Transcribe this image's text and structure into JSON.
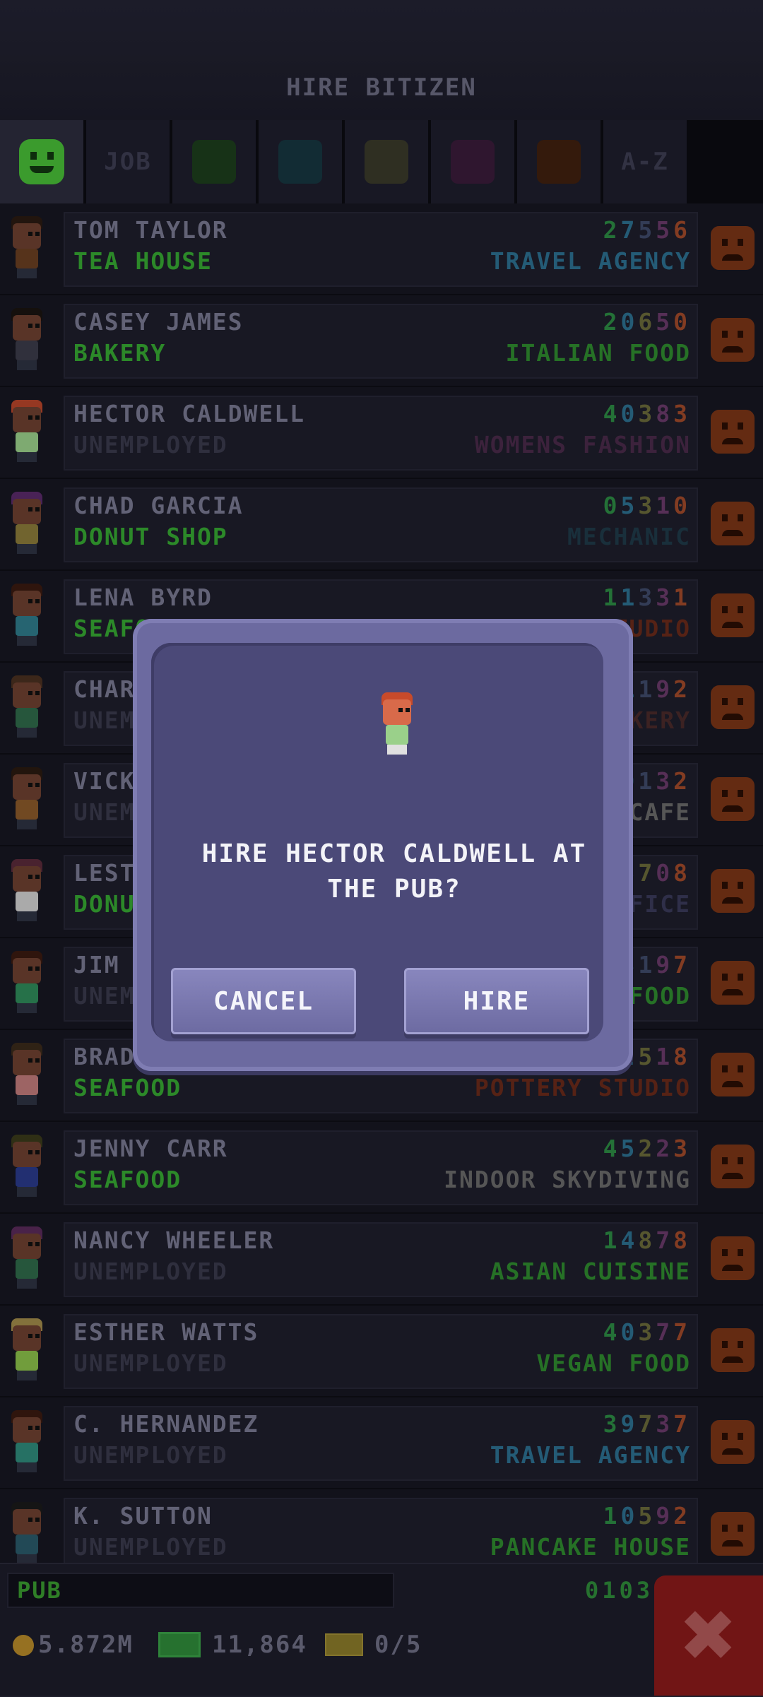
{
  "header": {
    "title": "HIRE BITIZEN"
  },
  "tabs": [
    {
      "type": "icon",
      "icon": "smiley-face-icon",
      "color": "#48bd38",
      "active": true
    },
    {
      "type": "text",
      "label": "JOB"
    },
    {
      "type": "swatch",
      "color": "#1d3d1d"
    },
    {
      "type": "swatch",
      "color": "#173640"
    },
    {
      "type": "swatch",
      "color": "#3a3a2a"
    },
    {
      "type": "swatch",
      "color": "#3a1c3a"
    },
    {
      "type": "swatch",
      "color": "#40200f"
    },
    {
      "type": "text",
      "label": "A-Z"
    }
  ],
  "rows": [
    {
      "name": "TOM TAYLOR",
      "job": "TEA HOUSE",
      "job_color": "#36a832",
      "digits": [
        "2",
        "7",
        "5",
        "5",
        "6"
      ],
      "digit_colors": [
        "#2d8a44",
        "#2d6f8f",
        "#3f4a6a",
        "#6a3a6a",
        "#a04a2a"
      ],
      "dream": "TRAVEL AGENCY",
      "dream_color": "#2c7090",
      "mood": "sad-face-icon",
      "hair": "#2a1a12",
      "shirt": "#6a3f22"
    },
    {
      "name": "CASEY JAMES",
      "job": "BAKERY",
      "job_color": "#36a832",
      "digits": [
        "2",
        "0",
        "6",
        "5",
        "0"
      ],
      "digit_colors": [
        "#2d8a44",
        "#2d6f8f",
        "#6a6a3a",
        "#6a3a6a",
        "#a04a2a"
      ],
      "dream": "ITALIAN FOOD",
      "dream_color": "#2f8a2f",
      "mood": "sad-face-icon",
      "hair": "#1a1410",
      "shirt": "#3b3b4a"
    },
    {
      "name": "HECTOR CALDWELL",
      "job": "UNEMPLOYED",
      "job_color": "#3a3a4c",
      "digits": [
        "4",
        "0",
        "3",
        "8",
        "3"
      ],
      "digit_colors": [
        "#2d8a44",
        "#2d6f8f",
        "#6a6a3a",
        "#6a3a6a",
        "#a04a2a"
      ],
      "dream": "WOMENS FASHION",
      "dream_color": "#4a2a4a",
      "mood": "sad-face-icon",
      "hair": "#b8452a",
      "shirt": "#9ad08a"
    },
    {
      "name": "CHAD GARCIA",
      "job": "DONUT SHOP",
      "job_color": "#36a832",
      "digits": [
        "0",
        "5",
        "3",
        "1",
        "0"
      ],
      "digit_colors": [
        "#2d8a44",
        "#2d6f8f",
        "#6a6a3a",
        "#6a3a6a",
        "#a04a2a"
      ],
      "dream": "MECHANIC",
      "dream_color": "#1f3a48",
      "mood": "sad-face-icon",
      "hair": "#5a2a6a",
      "shirt": "#8a7a3a"
    },
    {
      "name": "LENA BYRD",
      "job": "SEAFOOD",
      "job_color": "#36a832",
      "digits": [
        "1",
        "1",
        "3",
        "3",
        "1"
      ],
      "digit_colors": [
        "#2d8a44",
        "#2d6f8f",
        "#3f4a6a",
        "#6a3a6a",
        "#a04a2a"
      ],
      "dream": "POTTERY STUDIO",
      "dream_color": "#6a2a1a",
      "mood": "sad-face-icon",
      "hair": "#3a1a10",
      "shirt": "#2f7a8a"
    },
    {
      "name": "CHARLIE",
      "job": "UNEMPLOYED",
      "job_color": "#3a3a4c",
      "digits": [
        "4",
        "1",
        "1",
        "9",
        "2"
      ],
      "digit_colors": [
        "#2d8a44",
        "#2d6f8f",
        "#3f4a6a",
        "#6a3a6a",
        "#a04a2a"
      ],
      "dream": "BAKERY",
      "dream_color": "#4a2a2a",
      "mood": "sad-face-icon",
      "hair": "#4a3020",
      "shirt": "#2f6a4a"
    },
    {
      "name": "VICKY",
      "job": "UNEMPLOYED",
      "job_color": "#3a3a4c",
      "digits": [
        "3",
        "0",
        "1",
        "3",
        "2"
      ],
      "digit_colors": [
        "#2d8a44",
        "#2d6f8f",
        "#3f4a6a",
        "#6a3a6a",
        "#a04a2a"
      ],
      "dream": "CAFE",
      "dream_color": "#6a6a6a",
      "mood": "sad-face-icon",
      "hair": "#2a1a10",
      "shirt": "#8a5a2a"
    },
    {
      "name": "LESTER",
      "job": "DONUT SHOP",
      "job_color": "#36a832",
      "digits": [
        "1",
        "5",
        "7",
        "0",
        "8"
      ],
      "digit_colors": [
        "#2d8a44",
        "#2d6f8f",
        "#6a6a3a",
        "#6a3a6a",
        "#a04a2a"
      ],
      "dream": "OFFICE",
      "dream_color": "#3a3a5a",
      "mood": "sad-face-icon",
      "hair": "#5a2a3a",
      "shirt": "#d0d0d0"
    },
    {
      "name": "JIM",
      "job": "UNEMPLOYED",
      "job_color": "#3a3a4c",
      "digits": [
        "2",
        "3",
        "1",
        "9",
        "7"
      ],
      "digit_colors": [
        "#2d8a44",
        "#2d6f8f",
        "#3f4a6a",
        "#6a3a6a",
        "#a04a2a"
      ],
      "dream": "FOOD",
      "dream_color": "#2f8a2f",
      "mood": "sad-face-icon",
      "hair": "#3a1a10",
      "shirt": "#2f8a5a"
    },
    {
      "name": "BRAD",
      "job": "SEAFOOD",
      "job_color": "#36a832",
      "digits": [
        "4",
        "2",
        "5",
        "1",
        "8"
      ],
      "digit_colors": [
        "#2d8a44",
        "#2d6f8f",
        "#6a6a3a",
        "#6a3a6a",
        "#a04a2a"
      ],
      "dream": "POTTERY STUDIO",
      "dream_color": "#6a2a1a",
      "mood": "sad-face-icon",
      "hair": "#3a2a1a",
      "shirt": "#c07a7a"
    },
    {
      "name": "JENNY CARR",
      "job": "SEAFOOD",
      "job_color": "#36a832",
      "digits": [
        "4",
        "5",
        "2",
        "2",
        "3"
      ],
      "digit_colors": [
        "#2d8a44",
        "#2d6f8f",
        "#6a6a3a",
        "#6a3a6a",
        "#a04a2a"
      ],
      "dream": "INDOOR SKYDIVING",
      "dream_color": "#6a6a6a",
      "mood": "sad-face-icon",
      "hair": "#3a3a1a",
      "shirt": "#2a3a8a"
    },
    {
      "name": "NANCY WHEELER",
      "job": "UNEMPLOYED",
      "job_color": "#3a3a4c",
      "digits": [
        "1",
        "4",
        "8",
        "7",
        "8"
      ],
      "digit_colors": [
        "#2d8a44",
        "#2d6f8f",
        "#6a6a3a",
        "#6a3a6a",
        "#a04a2a"
      ],
      "dream": "ASIAN CUISINE",
      "dream_color": "#2f8a2f",
      "mood": "sad-face-icon",
      "hair": "#5a2a5a",
      "shirt": "#2f6a4a"
    },
    {
      "name": "ESTHER WATTS",
      "job": "UNEMPLOYED",
      "job_color": "#3a3a4c",
      "digits": [
        "4",
        "0",
        "3",
        "7",
        "7"
      ],
      "digit_colors": [
        "#2d8a44",
        "#2d6f8f",
        "#6a6a3a",
        "#6a3a6a",
        "#a04a2a"
      ],
      "dream": "VEGAN FOOD",
      "dream_color": "#2f8a2f",
      "mood": "sad-face-icon",
      "hair": "#a08a4a",
      "shirt": "#8ac04a"
    },
    {
      "name": "C. HERNANDEZ",
      "job": "UNEMPLOYED",
      "job_color": "#3a3a4c",
      "digits": [
        "3",
        "9",
        "7",
        "3",
        "7"
      ],
      "digit_colors": [
        "#2d8a44",
        "#2d6f8f",
        "#6a6a3a",
        "#6a3a6a",
        "#a04a2a"
      ],
      "dream": "TRAVEL AGENCY",
      "dream_color": "#2c7090",
      "mood": "sad-face-icon",
      "hair": "#3a1a10",
      "shirt": "#2f8a7a"
    },
    {
      "name": "K. SUTTON",
      "job": "UNEMPLOYED",
      "job_color": "#3a3a4c",
      "digits": [
        "1",
        "0",
        "5",
        "9",
        "2"
      ],
      "digit_colors": [
        "#2d8a44",
        "#2d6f8f",
        "#6a6a3a",
        "#6a3a6a",
        "#a04a2a"
      ],
      "dream": "PANCAKE HOUSE",
      "dream_color": "#2f8a2f",
      "mood": "sad-face-icon",
      "hair": "#1a1a1a",
      "shirt": "#2a5a6a"
    }
  ],
  "dialog": {
    "message": "HIRE HECTOR CALDWELL AT THE PUB?",
    "cancel_label": "CANCEL",
    "hire_label": "HIRE",
    "avatar_hair": "#c84a2a",
    "avatar_shirt": "#9ad08a"
  },
  "footer": {
    "floor_name": "PUB",
    "floor_digits": "0103",
    "coins": "5.872M",
    "bux": "11,864",
    "tickets": "0/5"
  }
}
